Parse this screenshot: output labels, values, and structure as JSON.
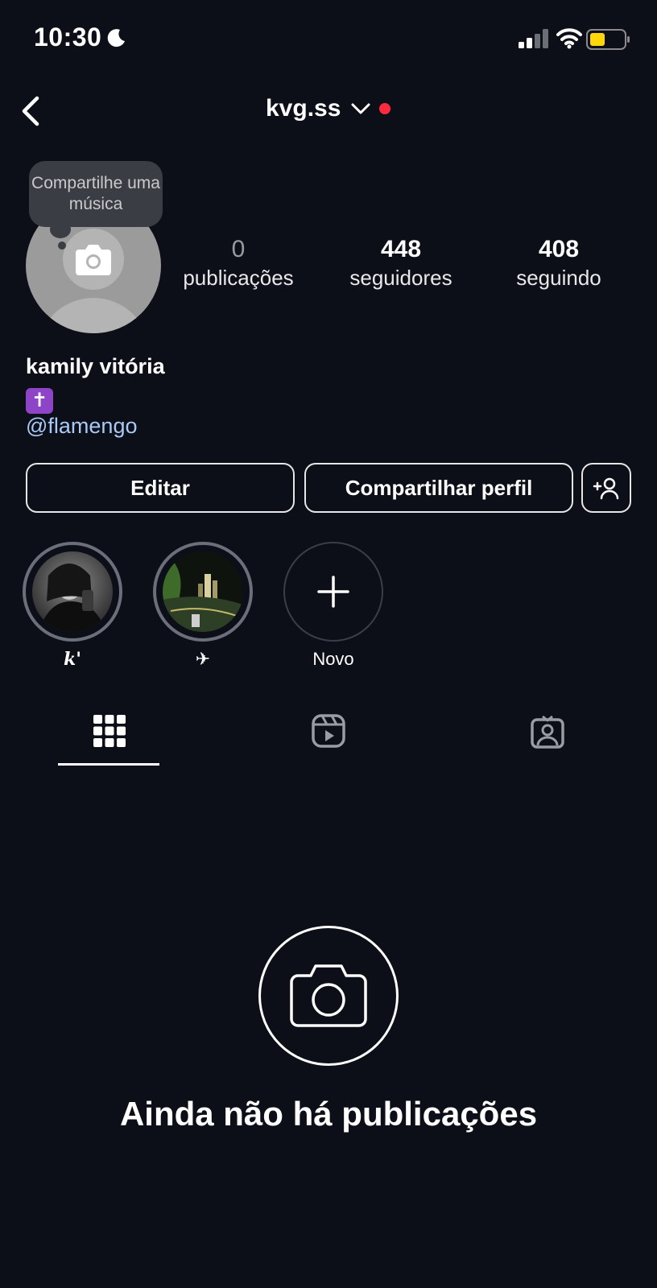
{
  "status_bar": {
    "time": "10:30"
  },
  "header": {
    "username": "kvg.ss"
  },
  "profile": {
    "tooltip": "Compartilhe uma música",
    "stats": [
      {
        "value": "0",
        "label": "publicações"
      },
      {
        "value": "448",
        "label": "seguidores"
      },
      {
        "value": "408",
        "label": "seguindo"
      }
    ],
    "full_name": "kamily vitória",
    "bio_emoji": "✝",
    "link": "@flamengo"
  },
  "actions": {
    "edit_label": "Editar",
    "share_label": "Compartilhar perfil"
  },
  "highlights": [
    {
      "label": "𝒌'"
    },
    {
      "label": "✈"
    },
    {
      "label": "Novo"
    }
  ],
  "empty_state": {
    "title": "Ainda não há publicações"
  },
  "colors": {
    "background": "#0c0f18",
    "link": "#a9c8f5",
    "notification_dot": "#ff2a3d",
    "battery": "#ffd60a"
  }
}
